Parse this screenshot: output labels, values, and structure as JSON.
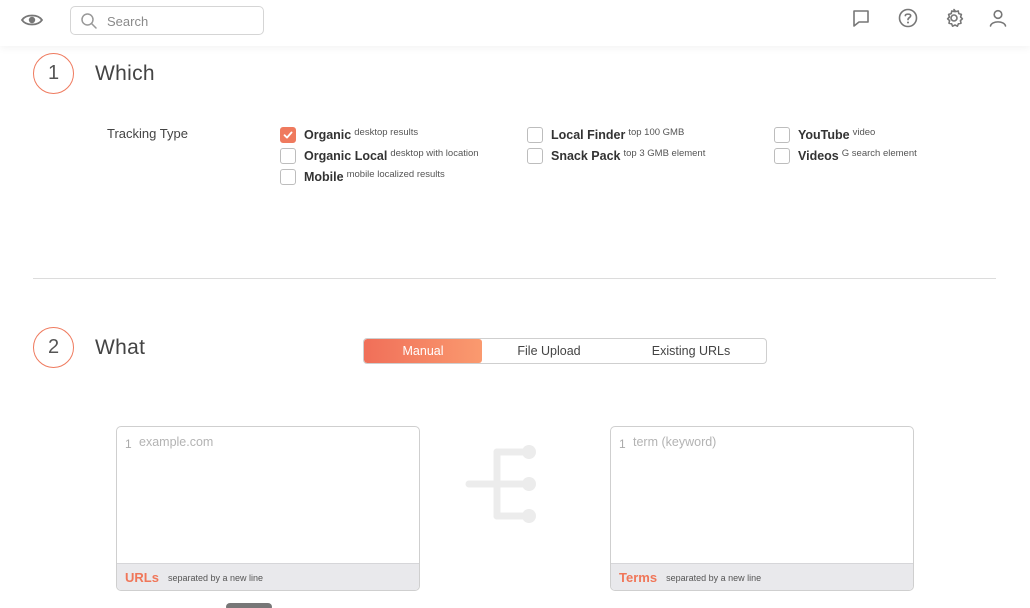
{
  "header": {
    "search_placeholder": "Search",
    "icons": [
      "eye-icon",
      "search-icon",
      "feedback-icon",
      "help-icon",
      "settings-icon",
      "user-icon"
    ]
  },
  "step1": {
    "number": "1",
    "title": "Which",
    "tracking_label": "Tracking Type",
    "options": [
      {
        "label": "Organic",
        "sub": "desktop results",
        "checked": true
      },
      {
        "label": "Organic Local",
        "sub": "desktop with location",
        "checked": false
      },
      {
        "label": "Mobile",
        "sub": "mobile localized results",
        "checked": false
      },
      {
        "label": "Local Finder",
        "sub": "top 100 GMB",
        "checked": false
      },
      {
        "label": "Snack Pack",
        "sub": "top 3 GMB element",
        "checked": false
      },
      {
        "label": "YouTube",
        "sub": "video",
        "checked": false
      },
      {
        "label": "Videos",
        "sub": "G search element",
        "checked": false
      }
    ]
  },
  "step2": {
    "number": "2",
    "title": "What",
    "tabs": [
      "Manual",
      "File Upload",
      "Existing URLs"
    ],
    "active_tab": "Manual",
    "urls": {
      "line_no": "1",
      "placeholder": "example.com",
      "footer_title": "URLs",
      "footer_sub": "separated by a new line"
    },
    "terms": {
      "line_no": "1",
      "placeholder": "term (keyword)",
      "footer_title": "Terms",
      "footer_sub": "separated by a new line"
    }
  },
  "colors": {
    "accent": "#ef7a5e",
    "accent_light": "#fa9a6f",
    "border": "#cfcfcf",
    "footer_bg": "#e9e9ec"
  }
}
